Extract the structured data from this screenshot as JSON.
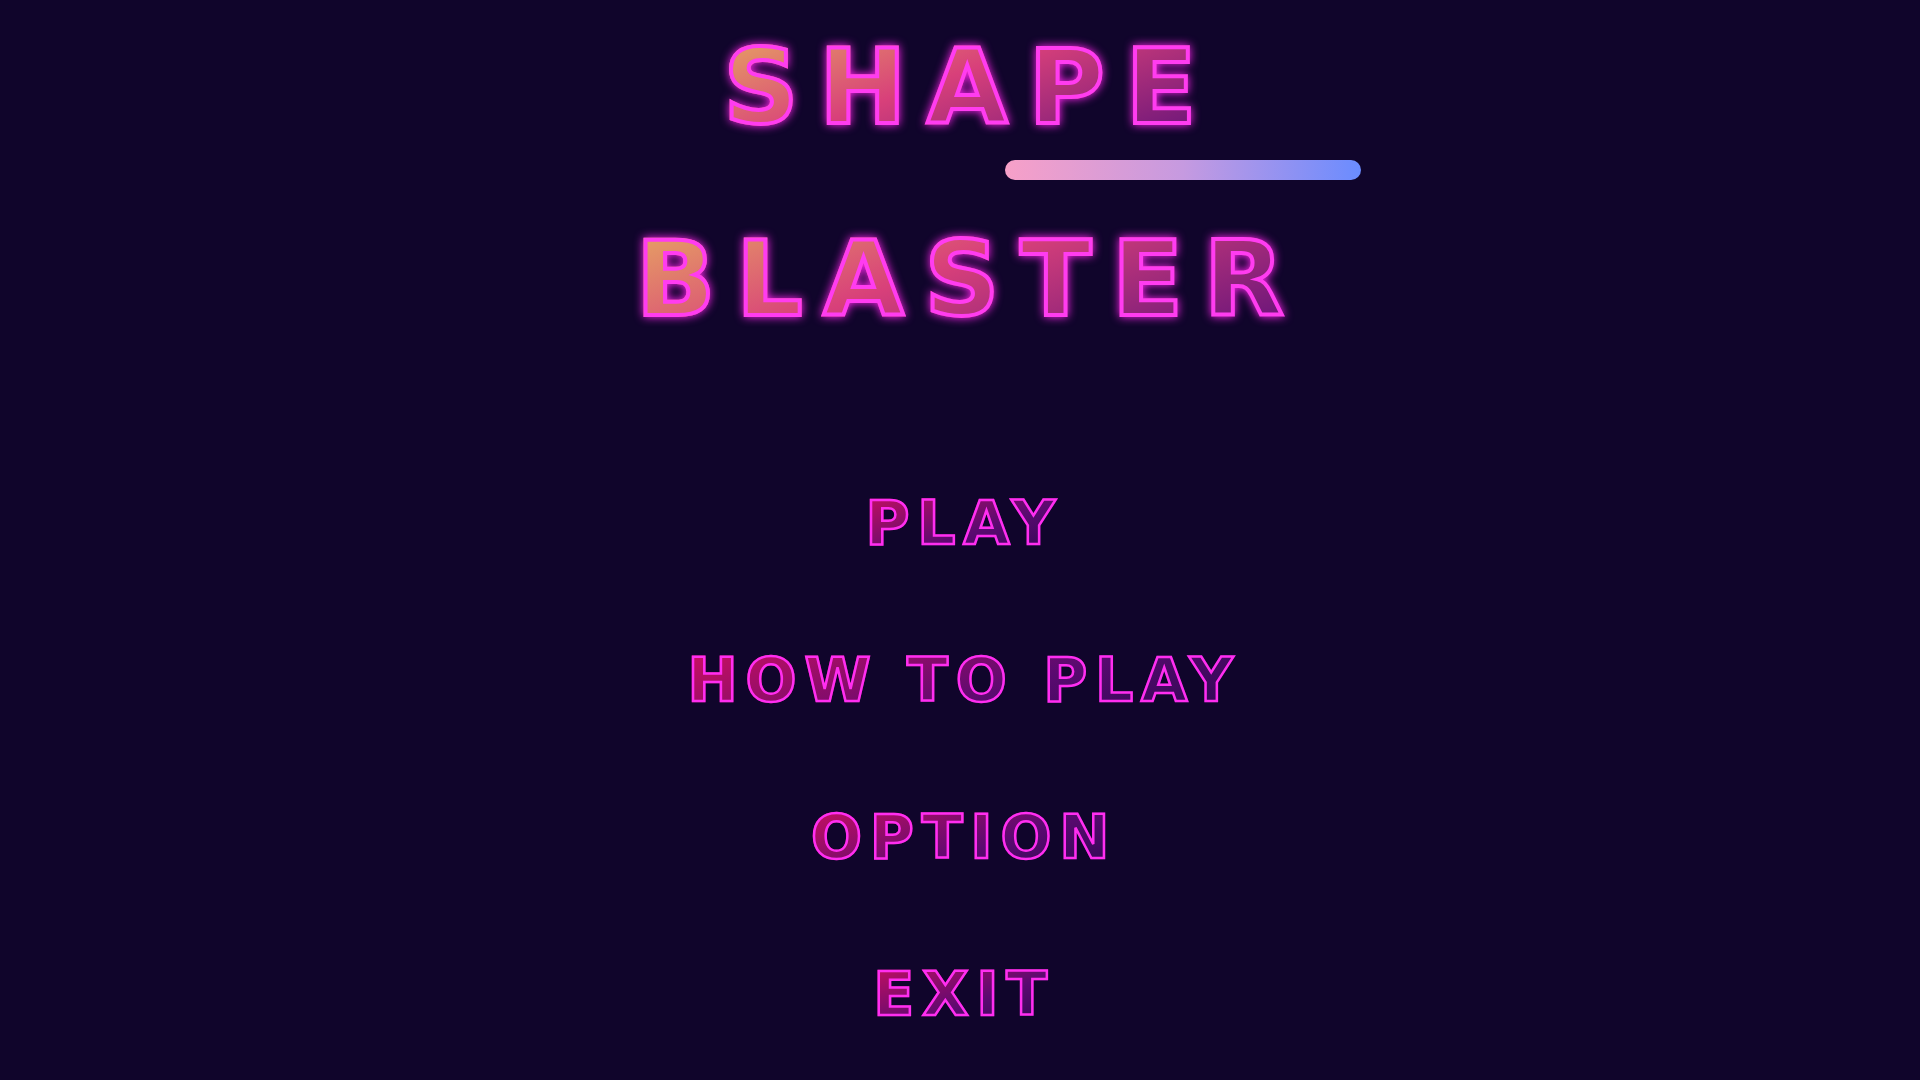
{
  "title": {
    "lines": [
      "SHAPE",
      "BLASTER"
    ]
  },
  "menu": {
    "items": [
      {
        "label": "PLAY"
      },
      {
        "label": "HOW TO PLAY"
      },
      {
        "label": "OPTION"
      },
      {
        "label": "EXIT"
      }
    ]
  }
}
